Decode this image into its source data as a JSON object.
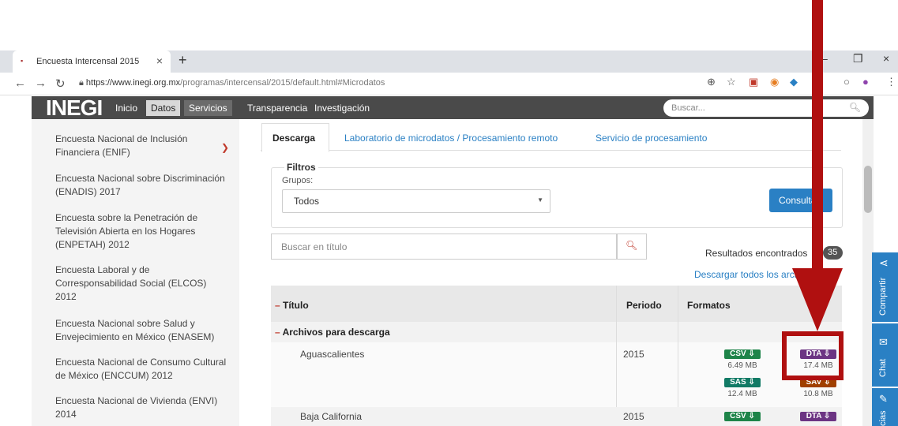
{
  "browser": {
    "tab_title": "Encuesta Intercensal 2015",
    "url_main": "https://www.inegi.org.mx",
    "url_path": "/programas/intercensal/2015/default.html#Microdatos"
  },
  "site": {
    "logo": "INEGI",
    "menu": [
      "Inicio",
      "Datos",
      "Servicios",
      "Transparencia",
      "Investigación"
    ],
    "search_placeholder": "Buscar..."
  },
  "sidebar": {
    "items": [
      "Encuesta Nacional de Inclusión Financiera (ENIF)",
      "Encuesta Nacional sobre Discriminación (ENADIS) 2017",
      "Encuesta sobre la Penetración de Televisión Abierta en los Hogares (ENPETAH) 2012",
      "Encuesta Laboral y de Corresponsabilidad Social (ELCOS) 2012",
      "Encuesta Nacional sobre Salud y Envejecimiento en México (ENASEM)",
      "Encuesta Nacional de Consumo Cultural de México (ENCCUM) 2012",
      "Encuesta Nacional de Vivienda (ENVI) 2014"
    ]
  },
  "tabs": [
    "Descarga",
    "Laboratorio de microdatos / Procesamiento remoto",
    "Servicio de procesamiento"
  ],
  "filters": {
    "legend": "Filtros",
    "group_label": "Grupos:",
    "group_value": "Todos",
    "button": "Consultar"
  },
  "search_title_placeholder": "Buscar en título",
  "results": {
    "label": "Resultados encontrados",
    "count": "35"
  },
  "download_all": "Descargar todos los archivos",
  "table": {
    "headers": [
      "Título",
      "Periodo",
      "Formatos"
    ],
    "section": "Archivos para descarga",
    "rows": [
      {
        "title": "Aguascalientes",
        "period": "2015",
        "formats": [
          {
            "label": "CSV",
            "size": "6.49 MB"
          },
          {
            "label": "DTA",
            "size": "17.4 MB"
          },
          {
            "label": "SAS",
            "size": "12.4 MB"
          },
          {
            "label": "SAV",
            "size": "10.8 MB"
          }
        ]
      },
      {
        "title": "Baja California",
        "period": "2015",
        "formats": [
          {
            "label": "CSV"
          },
          {
            "label": "DTA"
          }
        ]
      }
    ]
  },
  "floating": {
    "share": "Compartir",
    "chat": "Chat",
    "survey": "cias"
  },
  "colors": {
    "header": "#4a4a4a",
    "accent": "#2a80c4",
    "annotation": "#b01010"
  }
}
